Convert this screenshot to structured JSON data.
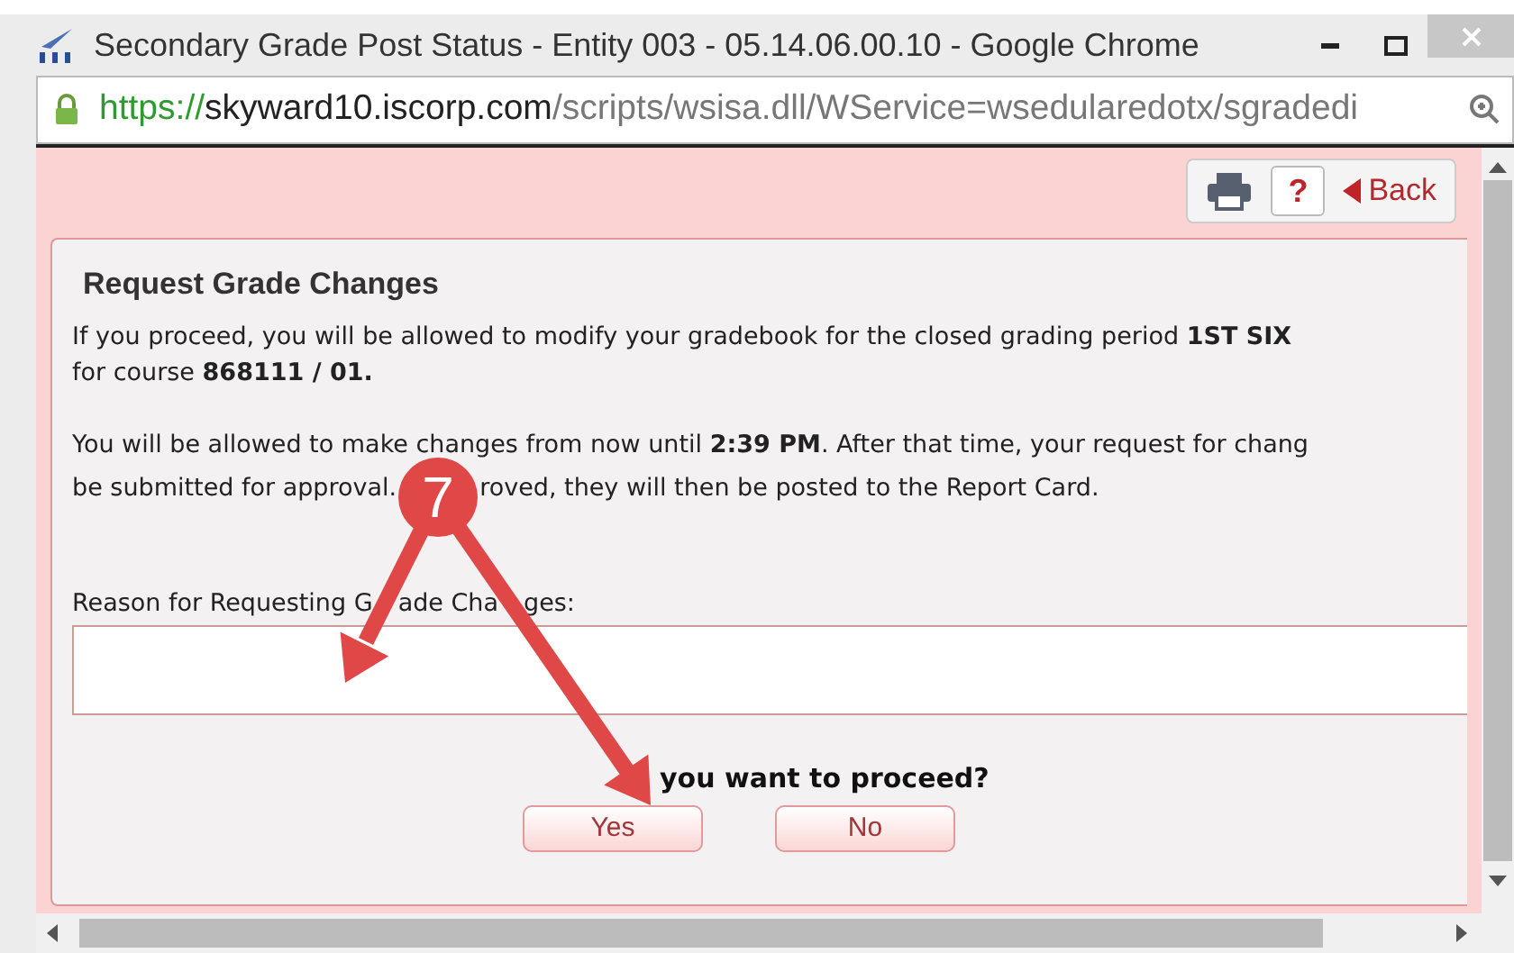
{
  "window": {
    "title": "Secondary Grade Post Status - Entity 003 - 05.14.06.00.10 - Google Chrome"
  },
  "address_bar": {
    "scheme": "https://",
    "host": "skyward10.iscorp.com",
    "path": "/scripts/wsisa.dll/WService=wsedularedotx/sgradedi"
  },
  "toolbar": {
    "help": "?",
    "back": "Back"
  },
  "dialog": {
    "title": "Request Grade Changes",
    "paragraph_1": [
      "If you proceed, you will be allowed to modify your gradebook for the closed grading period **1ST SIX**",
      "for course **868111 / 01.**"
    ],
    "paragraph_2_line_1": "You will be allowed to make changes from now until **2:39 PM**. After that time, your request for chang",
    "paragraph_2_line_2": [
      "be submitted for approval.",
      "roved, they will then be posted to the Report Card."
    ],
    "reason_label": [
      "Reason for Requesting G",
      "ade Cha",
      "ges:"
    ],
    "question": "you want to proceed?",
    "buttons": [
      {
        "label": "Yes"
      },
      {
        "label": "No"
      }
    ]
  },
  "annotation": {
    "step": "7"
  }
}
